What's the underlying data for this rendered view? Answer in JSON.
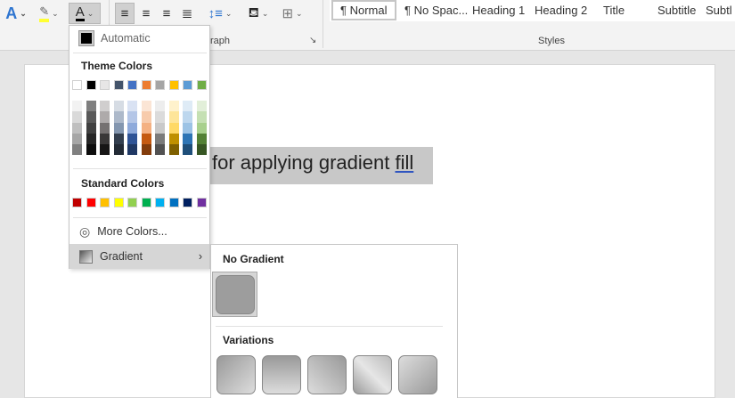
{
  "ribbon": {
    "paragraph_label": "Paragraph",
    "paragraph_visible": "raph",
    "styles_label": "Styles",
    "styles": [
      "¶ Normal",
      "¶ No Spac...",
      "Heading 1",
      "Heading 2",
      "Title",
      "Subtitle",
      "Subtl"
    ]
  },
  "document": {
    "text_before": "for applying gradient ",
    "text_underlined": "fill"
  },
  "font_color_menu": {
    "automatic": "Automatic",
    "theme_colors_label": "Theme Colors",
    "theme_colors": [
      "#ffffff",
      "#000000",
      "#e7e6e6",
      "#44546a",
      "#4472c4",
      "#ed7d31",
      "#a5a5a5",
      "#ffc000",
      "#5b9bd5",
      "#70ad47"
    ],
    "theme_shades": [
      [
        "#f2f2f2",
        "#d9d9d9",
        "#bfbfbf",
        "#a6a6a6",
        "#808080"
      ],
      [
        "#7f7f7f",
        "#595959",
        "#404040",
        "#262626",
        "#0d0d0d"
      ],
      [
        "#d0cece",
        "#aeaaaa",
        "#757171",
        "#3a3838",
        "#171616"
      ],
      [
        "#d6dce4",
        "#adb9ca",
        "#8497b0",
        "#333f4f",
        "#222a35"
      ],
      [
        "#d9e2f3",
        "#b4c6e7",
        "#8eaadb",
        "#2f5496",
        "#1f3864"
      ],
      [
        "#fbe5d5",
        "#f7cbac",
        "#f4b183",
        "#c55a11",
        "#833c0b"
      ],
      [
        "#ededed",
        "#dbdbdb",
        "#c9c9c9",
        "#7b7b7b",
        "#525252"
      ],
      [
        "#fff2cc",
        "#fee599",
        "#ffd966",
        "#bf9000",
        "#7f6000"
      ],
      [
        "#deebf6",
        "#bdd7ee",
        "#9cc3e5",
        "#2e75b5",
        "#1e4e79"
      ],
      [
        "#e2efd9",
        "#c5e0b3",
        "#a8d08d",
        "#538135",
        "#375623"
      ]
    ],
    "standard_colors_label": "Standard Colors",
    "standard_colors": [
      "#c00000",
      "#ff0000",
      "#ffc000",
      "#ffff00",
      "#92d050",
      "#00b050",
      "#00b0f0",
      "#0070c0",
      "#002060",
      "#7030a0"
    ],
    "more_colors": "More Colors...",
    "gradient": "Gradient"
  },
  "gradient_menu": {
    "no_gradient": "No Gradient",
    "variations": "Variations"
  }
}
